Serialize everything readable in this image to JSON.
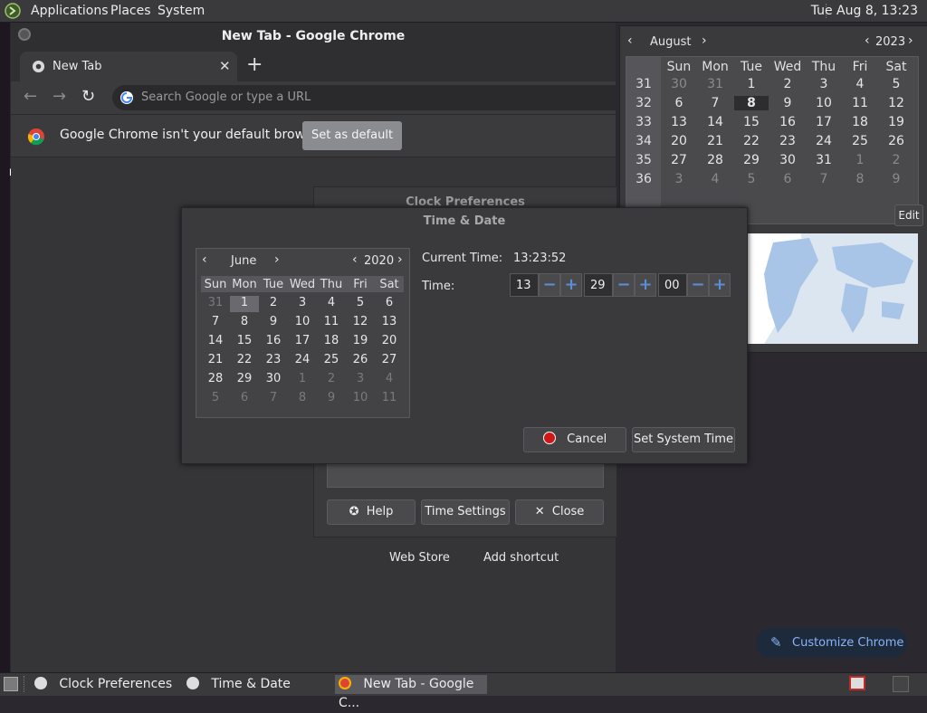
{
  "top_panel": {
    "menus": [
      "Applications",
      "Places",
      "System"
    ],
    "clock": "Tue Aug  8, 13:23"
  },
  "chrome": {
    "window_title": "New Tab - Google Chrome",
    "tab_title": "New Tab",
    "omnibox_placeholder": "Search Google or type a URL",
    "infobar_text": "Google Chrome isn't your default browser",
    "set_default_label": "Set as default",
    "ntp_links": [
      "Web Store",
      "Add shortcut"
    ],
    "customize_label": "Customize Chrome"
  },
  "panel_calendar": {
    "month": "August",
    "year": "2023",
    "weekday_headers": [
      "Sun",
      "Mon",
      "Tue",
      "Wed",
      "Thu",
      "Fri",
      "Sat"
    ],
    "weeks": [
      {
        "num": "31",
        "days": [
          "30",
          "31",
          "1",
          "2",
          "3",
          "4",
          "5"
        ]
      },
      {
        "num": "32",
        "days": [
          "6",
          "7",
          "8",
          "9",
          "10",
          "11",
          "12"
        ]
      },
      {
        "num": "33",
        "days": [
          "13",
          "14",
          "15",
          "16",
          "17",
          "18",
          "19"
        ]
      },
      {
        "num": "34",
        "days": [
          "20",
          "21",
          "22",
          "23",
          "24",
          "25",
          "26"
        ]
      },
      {
        "num": "35",
        "days": [
          "27",
          "28",
          "29",
          "30",
          "31",
          "1",
          "2"
        ]
      },
      {
        "num": "36",
        "days": [
          "3",
          "4",
          "5",
          "6",
          "7",
          "8",
          "9"
        ]
      }
    ],
    "today": "8",
    "edit_label": "Edit"
  },
  "clock_prefs": {
    "title": "Clock Preferences",
    "help_label": "Help",
    "time_settings_label": "Time Settings",
    "close_label": "Close"
  },
  "time_date": {
    "title": "Time & Date",
    "month": "June",
    "year": "2020",
    "weekday_headers": [
      "Sun",
      "Mon",
      "Tue",
      "Wed",
      "Thu",
      "Fri",
      "Sat"
    ],
    "weeks": [
      [
        "31",
        "1",
        "2",
        "3",
        "4",
        "5",
        "6"
      ],
      [
        "7",
        "8",
        "9",
        "10",
        "11",
        "12",
        "13"
      ],
      [
        "14",
        "15",
        "16",
        "17",
        "18",
        "19",
        "20"
      ],
      [
        "21",
        "22",
        "23",
        "24",
        "25",
        "26",
        "27"
      ],
      [
        "28",
        "29",
        "30",
        "1",
        "2",
        "3",
        "4"
      ],
      [
        "5",
        "6",
        "7",
        "8",
        "9",
        "10",
        "11"
      ]
    ],
    "selected_day": "1",
    "current_time_label": "Current Time:",
    "current_time_value": "13:23:52",
    "time_label": "Time:",
    "hours": "13",
    "minutes": "29",
    "seconds": "00",
    "cancel_label": "Cancel",
    "set_time_label": "Set System Time"
  },
  "taskbar": {
    "tasks": [
      "Clock Preferences",
      "Time & Date",
      "New Tab - Google C..."
    ]
  }
}
